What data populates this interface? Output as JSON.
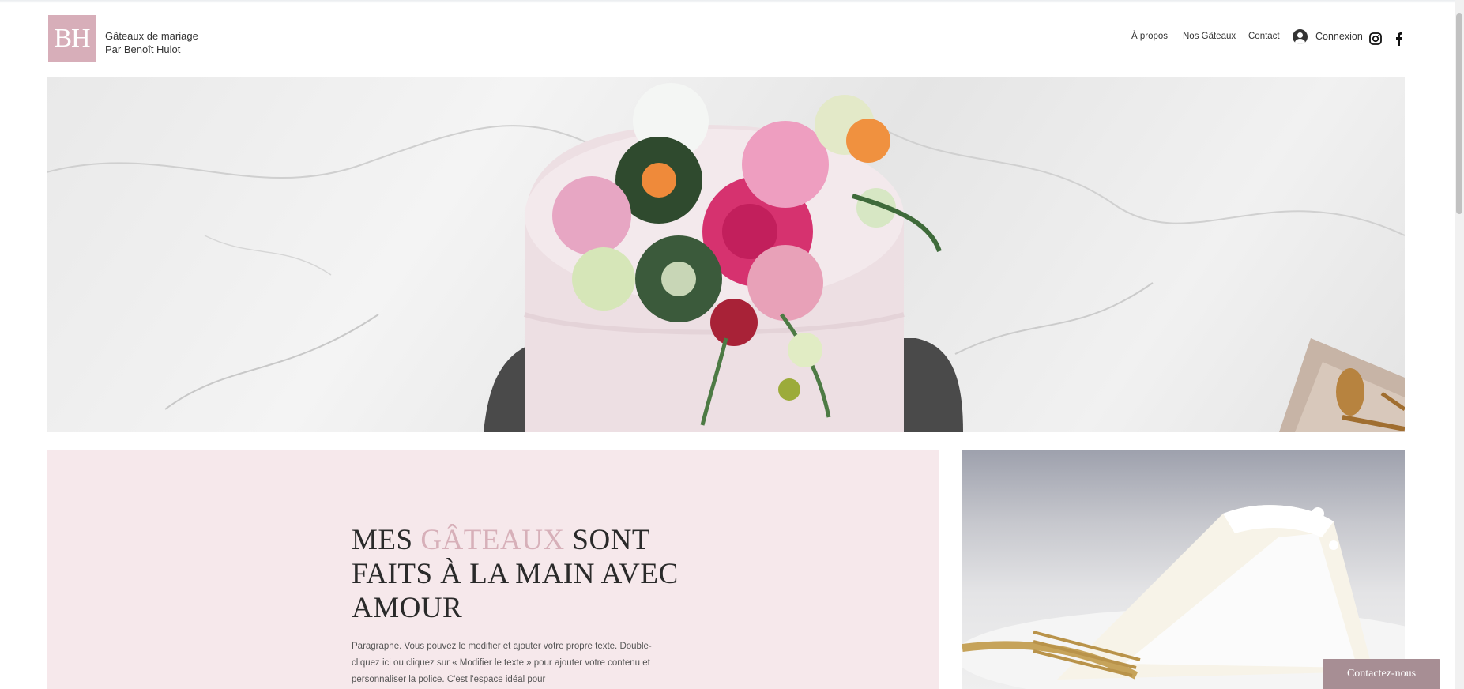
{
  "header": {
    "logo_text": "BH",
    "brand_line1": "Gâteaux de mariage",
    "brand_line2": "Par Benoît Hulot",
    "nav": [
      "À propos",
      "Nos Gâteaux",
      "Contact"
    ],
    "login_label": "Connexion",
    "icons": [
      "user-icon",
      "instagram-icon",
      "facebook-icon"
    ]
  },
  "hero": {
    "image": "wedding cake with flower bouquet on marble background"
  },
  "intro": {
    "headline_1": "MES ",
    "headline_accent": "GÂTEAUX",
    "headline_2": " SONT FAITS À LA MAIN AVEC AMOUR",
    "paragraph": "Paragraphe. Vous pouvez le modifier et ajouter votre propre texte. Double-cliquez ici ou cliquez sur « Modifier le texte » pour ajouter votre contenu et personnaliser la police. C'est l'espace idéal pour"
  },
  "side_image": {
    "image": "slice of white cake with golden fork"
  },
  "chat_button": "Contactez-nous",
  "colors": {
    "accent": "#d7aeb9",
    "panel": "#f6e8eb",
    "button": "#a78e94"
  }
}
